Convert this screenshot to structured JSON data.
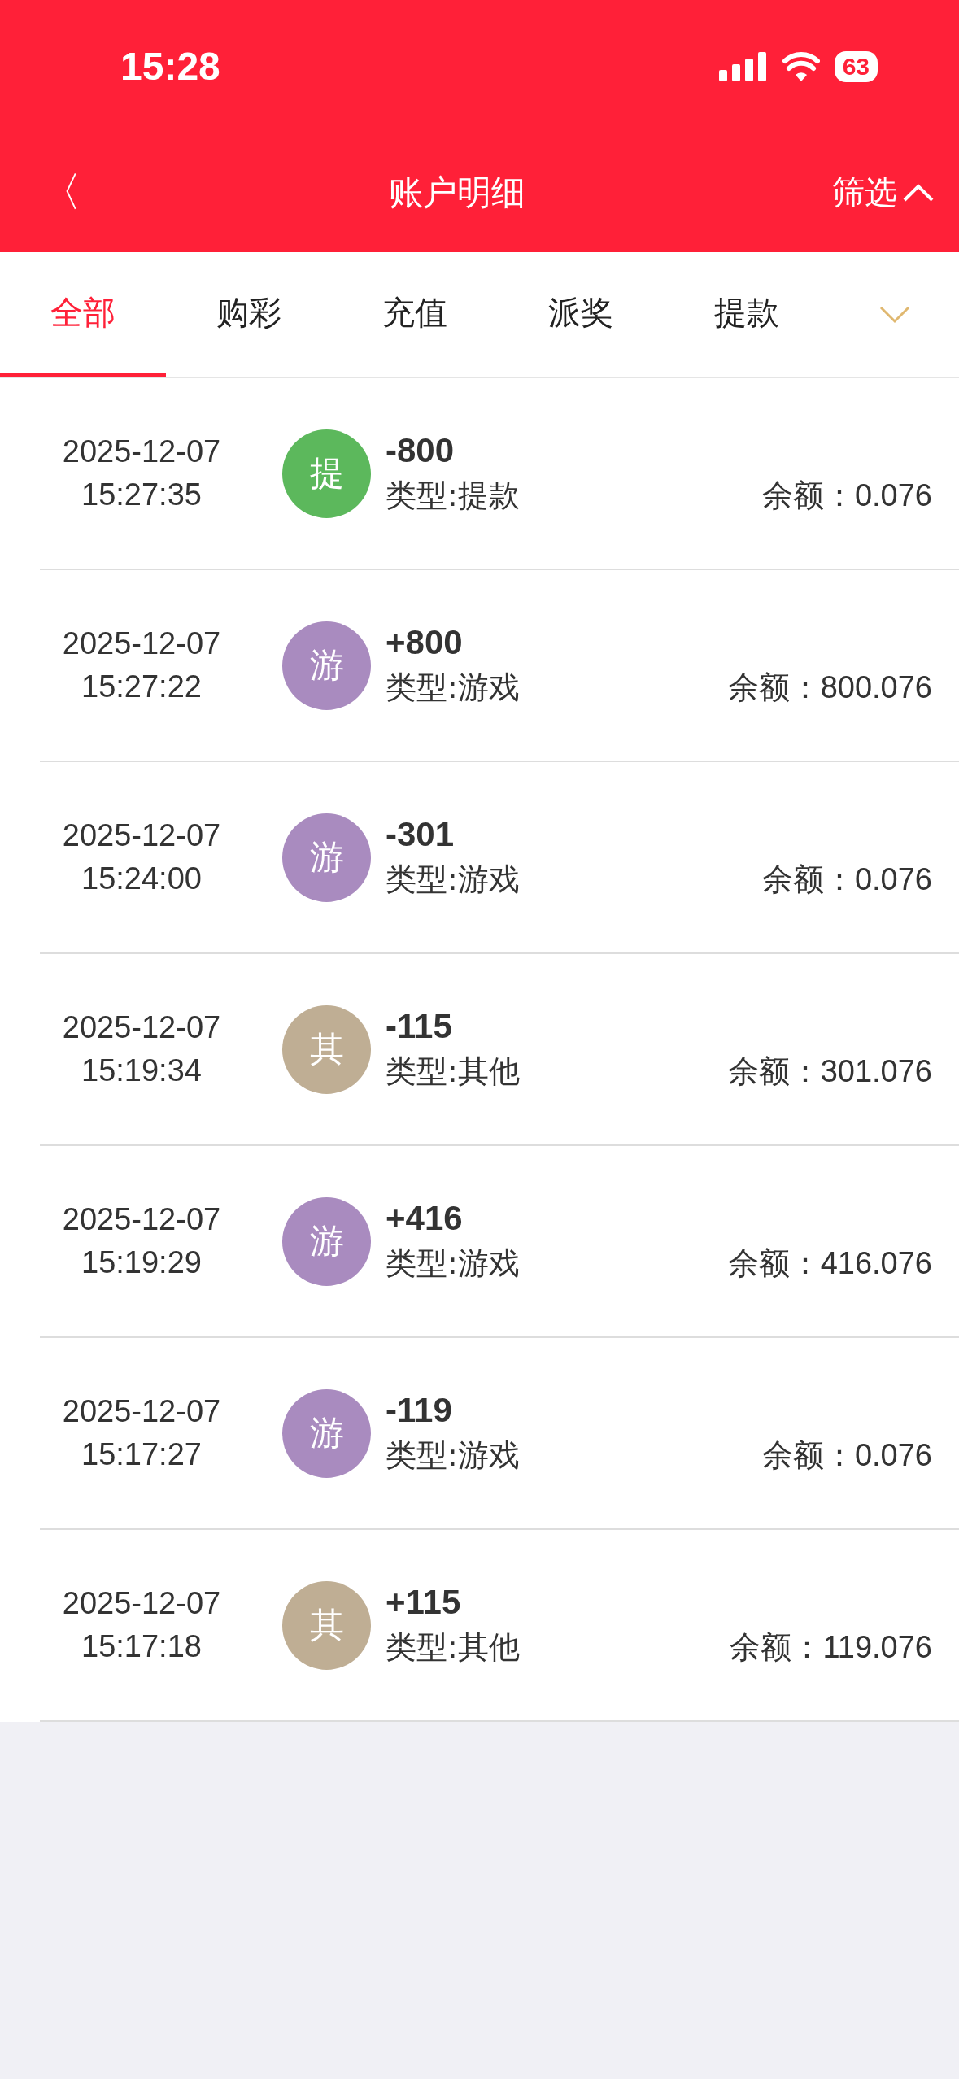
{
  "status_bar": {
    "time": "15:28",
    "battery": "63"
  },
  "nav": {
    "back": "〈",
    "title": "账户明细",
    "filter": "筛选"
  },
  "tabs": [
    {
      "label": "全部",
      "selected": true
    },
    {
      "label": "购彩",
      "selected": false
    },
    {
      "label": "充值",
      "selected": false
    },
    {
      "label": "派奖",
      "selected": false
    },
    {
      "label": "提款",
      "selected": false
    }
  ],
  "records": [
    {
      "date": "2025-12-07",
      "time": "15:27:35",
      "badge": "提",
      "color": "#5cb85c",
      "amount": "-800",
      "type": "类型:提款",
      "balance_label": "余额：",
      "balance": "0.076"
    },
    {
      "date": "2025-12-07",
      "time": "15:27:22",
      "badge": "游",
      "color": "#a98bbf",
      "amount": "+800",
      "type": "类型:游戏",
      "balance_label": "余额：",
      "balance": "800.076"
    },
    {
      "date": "2025-12-07",
      "time": "15:24:00",
      "badge": "游",
      "color": "#a98bbf",
      "amount": "-301",
      "type": "类型:游戏",
      "balance_label": "余额：",
      "balance": "0.076"
    },
    {
      "date": "2025-12-07",
      "time": "15:19:34",
      "badge": "其",
      "color": "#bfae94",
      "amount": "-115",
      "type": "类型:其他",
      "balance_label": "余额：",
      "balance": "301.076"
    },
    {
      "date": "2025-12-07",
      "time": "15:19:29",
      "badge": "游",
      "color": "#a98bbf",
      "amount": "+416",
      "type": "类型:游戏",
      "balance_label": "余额：",
      "balance": "416.076"
    },
    {
      "date": "2025-12-07",
      "time": "15:17:27",
      "badge": "游",
      "color": "#a98bbf",
      "amount": "-119",
      "type": "类型:游戏",
      "balance_label": "余额：",
      "balance": "0.076"
    },
    {
      "date": "2025-12-07",
      "time": "15:17:18",
      "badge": "其",
      "color": "#bfae94",
      "amount": "+115",
      "type": "类型:其他",
      "balance_label": "余额：",
      "balance": "119.076"
    }
  ]
}
